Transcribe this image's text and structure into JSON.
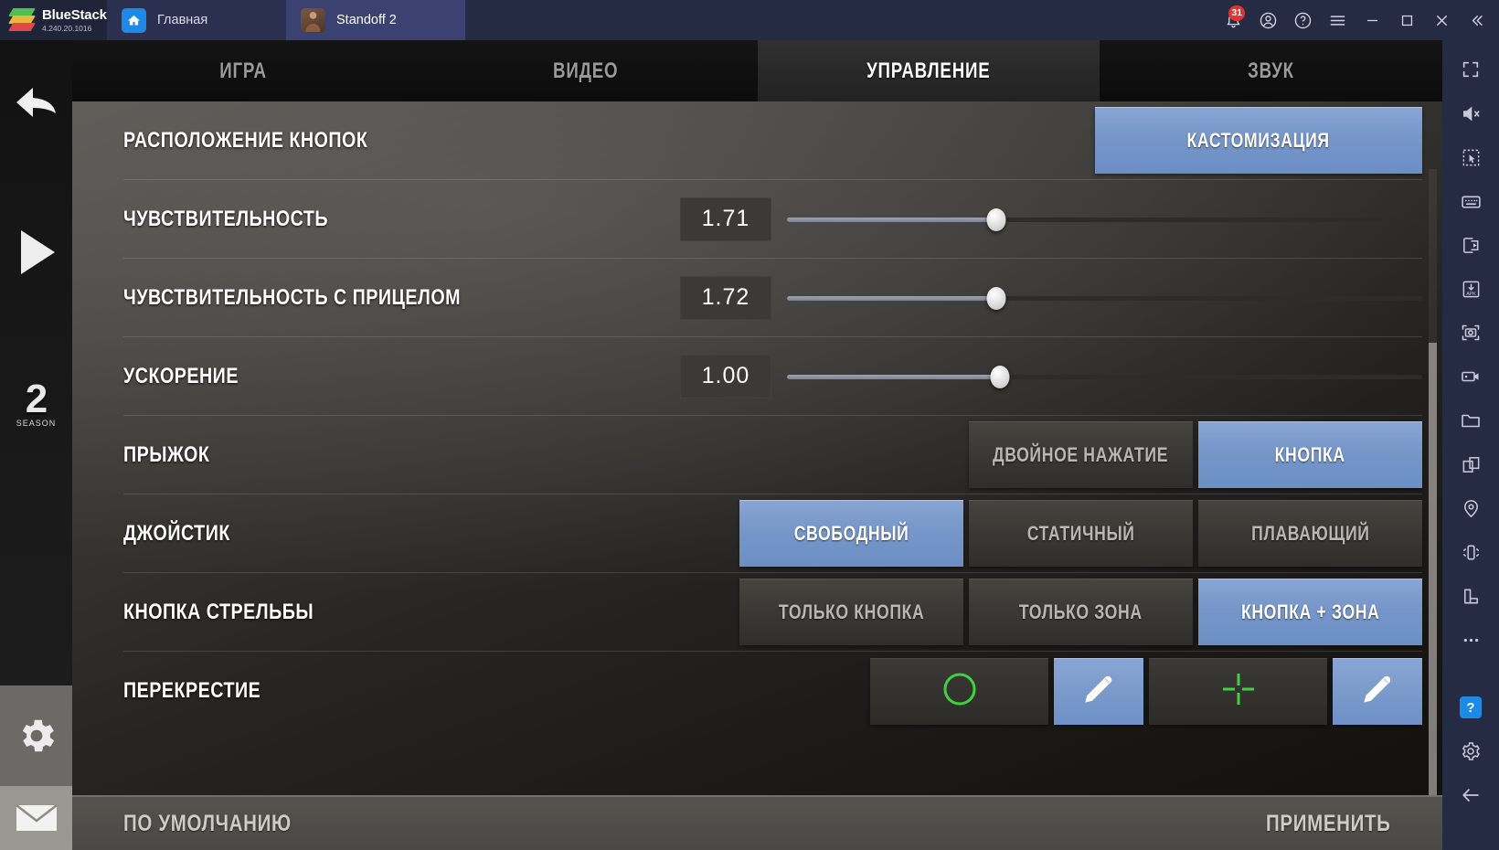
{
  "titlebar": {
    "brand": "BlueStacks",
    "version": "4.240.20.1016",
    "tabs": [
      {
        "label": "Главная",
        "icon": "home-icon",
        "active": false
      },
      {
        "label": "Standoff 2",
        "icon": "game-app-icon",
        "active": true
      }
    ],
    "icons": [
      {
        "name": "bell-icon",
        "badge": "31"
      },
      {
        "name": "account-icon",
        "badge": ""
      },
      {
        "name": "help-circle-icon",
        "badge": ""
      },
      {
        "name": "menu-icon",
        "badge": ""
      },
      {
        "name": "minimize-icon",
        "badge": ""
      },
      {
        "name": "maximize-icon",
        "badge": ""
      },
      {
        "name": "close-icon",
        "badge": ""
      },
      {
        "name": "collapse-left-icon",
        "badge": ""
      }
    ]
  },
  "right_toolbar": {
    "items": [
      "fullscreen-icon",
      "mute-icon",
      "multi-select-icon",
      "keyboard-controls-icon",
      "copy-to-device-icon",
      "install-apk-icon",
      "screenshot-icon",
      "record-screen-icon",
      "media-folder-icon",
      "multi-instance-icon",
      "location-icon",
      "shake-icon",
      "rotate-icon",
      "more-icon",
      "help-icon",
      "settings-icon",
      "back-icon"
    ]
  },
  "game_rail": {
    "items": [
      "back-arrow-icon",
      "play-icon",
      "season-badge",
      "gear-icon",
      "mail-icon"
    ],
    "season_number": "2",
    "season_label": "SEASON"
  },
  "tabs": {
    "items": [
      {
        "label": "ИГРА",
        "selected": false
      },
      {
        "label": "ВИДЕО",
        "selected": false
      },
      {
        "label": "УПРАВЛЕНИЕ",
        "selected": true
      },
      {
        "label": "ЗВУК",
        "selected": false
      }
    ]
  },
  "settings": {
    "button_layout": {
      "label": "РАСПОЛОЖЕНИЕ КНОПОК",
      "action_label": "КАСТОМИЗАЦИЯ"
    },
    "sensitivity": {
      "label": "ЧУВСТВИТЕЛЬНОСТЬ",
      "value": "1.71",
      "percent": 33
    },
    "scope_sensitivity": {
      "label": "ЧУВСТВИТЕЛЬНОСТЬ С ПРИЦЕЛОМ",
      "value": "1.72",
      "percent": 33
    },
    "acceleration": {
      "label": "УСКОРЕНИЕ",
      "value": "1.00",
      "percent": 33.5
    },
    "jump": {
      "label": "ПРЫЖОК",
      "options": [
        {
          "label": "ДВОЙНОЕ НАЖАТИЕ",
          "selected": false
        },
        {
          "label": "КНОПКА",
          "selected": true
        }
      ]
    },
    "joystick": {
      "label": "ДЖОЙСТИК",
      "options": [
        {
          "label": "СВОБОДНЫЙ",
          "selected": true
        },
        {
          "label": "СТАТИЧНЫЙ",
          "selected": false
        },
        {
          "label": "ПЛАВАЮЩИЙ",
          "selected": false
        }
      ]
    },
    "fire_button": {
      "label": "КНОПКА СТРЕЛЬБЫ",
      "options": [
        {
          "label": "ТОЛЬКО КНОПКА",
          "selected": false
        },
        {
          "label": "ТОЛЬКО ЗОНА",
          "selected": false
        },
        {
          "label": "КНОПКА + ЗОНА",
          "selected": true
        }
      ]
    },
    "crosshair": {
      "label": "ПЕРЕКРЕСТИЕ",
      "color": "#3fd23f",
      "items": [
        {
          "icon": "crosshair-circle-icon",
          "edit_icon": "pencil-icon"
        },
        {
          "icon": "crosshair-cross-icon",
          "edit_icon": "pencil-icon"
        }
      ]
    }
  },
  "footer": {
    "default_label": "ПО УМОЛЧАНИЮ",
    "apply_label": "ПРИМЕНИТЬ"
  }
}
